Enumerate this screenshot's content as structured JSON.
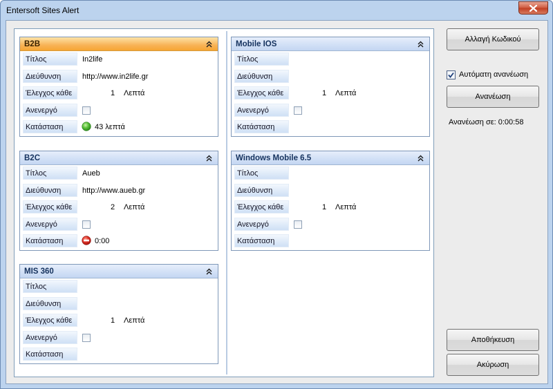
{
  "window": {
    "title": "Entersoft Sites Alert"
  },
  "labels": {
    "title": "Τίτλος",
    "address": "Διεύθυνση",
    "check_every": "Έλεγχος κάθε",
    "inactive": "Ανενεργό",
    "status": "Κατάσταση",
    "minutes": "Λεπτά"
  },
  "groups": [
    {
      "name": "B2B",
      "title": "In2life",
      "address": "http://www.in2life.gr",
      "interval": "1",
      "inactive": false,
      "status": "43 λεπτά",
      "status_kind": "ok",
      "active": true
    },
    {
      "name": "B2C",
      "title": "Aueb",
      "address": "http://www.aueb.gr",
      "interval": "2",
      "inactive": false,
      "status": "0:00",
      "status_kind": "error",
      "active": false
    },
    {
      "name": "MIS 360",
      "title": "",
      "address": "",
      "interval": "1",
      "inactive": false,
      "status": "",
      "status_kind": "none",
      "active": false
    },
    {
      "name": "Mobile IOS",
      "title": "",
      "address": "",
      "interval": "1",
      "inactive": false,
      "status": "",
      "status_kind": "none",
      "active": false
    },
    {
      "name": "Windows Mobile 6.5",
      "title": "",
      "address": "",
      "interval": "1",
      "inactive": false,
      "status": "",
      "status_kind": "none",
      "active": false
    }
  ],
  "side": {
    "change_password": "Αλλαγή Κωδικού",
    "auto_refresh": "Αυτόματη ανανέωση",
    "auto_refresh_checked": true,
    "refresh": "Ανανέωση",
    "refresh_in": "Ανανέωση σε: 0:00:58",
    "save": "Αποθήκευση",
    "cancel": "Ακύρωση"
  },
  "colors": {
    "active_header": "#f6a533",
    "header": "#c3d6f2",
    "status_ok": "#3fae2a",
    "status_error": "#d9241b"
  }
}
